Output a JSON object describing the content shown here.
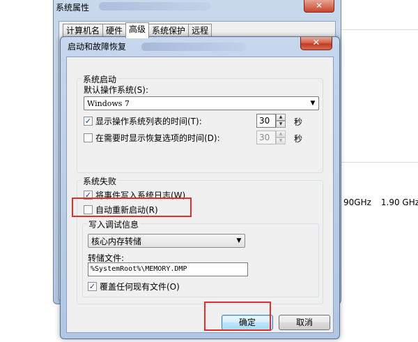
{
  "background": {
    "cpu_text": [
      "90GHz",
      "1.90 GHz"
    ]
  },
  "back_window": {
    "title": "系统属性",
    "close_glyph": "✕",
    "tabs": [
      "计算机名",
      "硬件",
      "高级",
      "系统保护",
      "远程"
    ],
    "active_tab": "高级"
  },
  "dialog": {
    "title": "启动和故障恢复",
    "close_glyph": "✕",
    "startup": {
      "legend": "系统启动",
      "default_os_label": "默认操作系统(S):",
      "default_os_value": "Windows 7",
      "show_list_label": "显示操作系统列表的时间(T):",
      "show_list_checked": true,
      "show_list_value": "30",
      "show_recovery_label": "在需要时显示恢复选项的时间(D):",
      "show_recovery_checked": false,
      "show_recovery_value": "30",
      "unit": "秒"
    },
    "failure": {
      "legend": "系统失败",
      "write_event_label": "将事件写入系统日志(W)",
      "write_event_checked": true,
      "auto_restart_label": "自动重新启动(R)",
      "auto_restart_checked": false,
      "debug_legend": "写入调试信息",
      "debug_value": "核心内存转储",
      "dump_file_label": "转储文件:",
      "dump_file_value": "%SystemRoot%\\MEMORY.DMP",
      "overwrite_label": "覆盖任何现有文件(O)",
      "overwrite_checked": true
    },
    "ok_label": "确定",
    "cancel_label": "取消"
  },
  "colors": {
    "highlight_red": "#e32d2d",
    "title_blue": "#c6d7ee"
  }
}
